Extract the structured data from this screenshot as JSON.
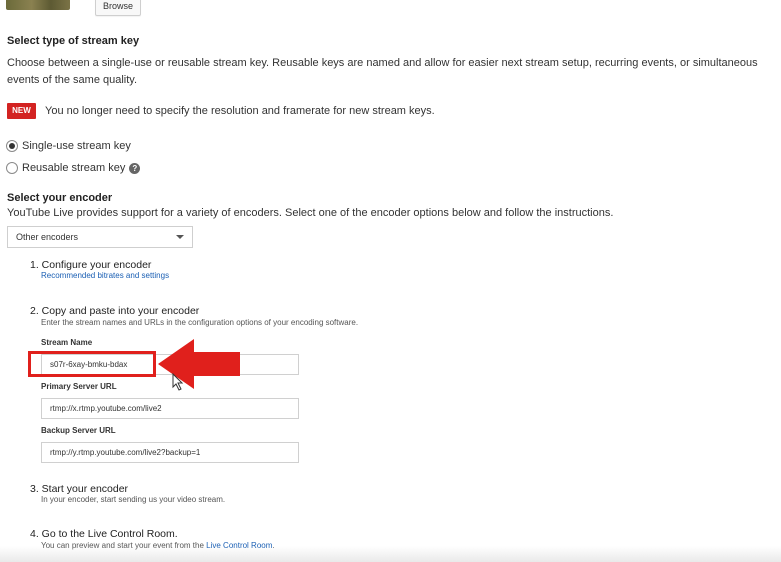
{
  "top": {
    "browse_label": "Browse"
  },
  "stream_key": {
    "heading": "Select type of stream key",
    "description": "Choose between a single-use or reusable stream key. Reusable keys are named and allow for easier next stream setup, recurring events, or simultaneous events of the same quality.",
    "new_badge": "NEW",
    "new_note": "You no longer need to specify the resolution and framerate for new stream keys.",
    "options": [
      {
        "label": "Single-use stream key",
        "selected": true
      },
      {
        "label": "Reusable stream key",
        "selected": false
      }
    ],
    "help_glyph": "?"
  },
  "encoder": {
    "heading": "Select your encoder",
    "description": "YouTube Live provides support for a variety of encoders. Select one of the encoder options below and follow the instructions.",
    "selected": "Other encoders"
  },
  "steps": [
    {
      "title": "1. Configure your encoder",
      "sub_link": "Recommended bitrates and settings"
    },
    {
      "title": "2. Copy and paste into your encoder",
      "sub": "Enter the stream names and URLs in the configuration options of your encoding software."
    },
    {
      "title": "3. Start your encoder",
      "sub": "In your encoder, start sending us your video stream."
    },
    {
      "title": "4. Go to the Live Control Room.",
      "sub_prefix": "You can preview and start your event from the ",
      "sub_link": "Live Control Room",
      "sub_suffix": "."
    }
  ],
  "fields": {
    "stream_name_label": "Stream Name",
    "stream_name_value": "s07r-6xay-bmku-bdax",
    "primary_label": "Primary Server URL",
    "primary_value": "rtmp://x.rtmp.youtube.com/live2",
    "backup_label": "Backup Server URL",
    "backup_value": "rtmp://y.rtmp.youtube.com/live2?backup=1"
  },
  "annotation": {
    "color": "#e0201c"
  },
  "colors": {
    "new_badge": "#d32322",
    "link": "#1a5fb4"
  },
  "icons": {
    "help": "help-circle-icon",
    "dropdown": "chevron-down-icon",
    "arrow": "red-arrow-left-icon",
    "cursor": "mouse-pointer-icon"
  }
}
